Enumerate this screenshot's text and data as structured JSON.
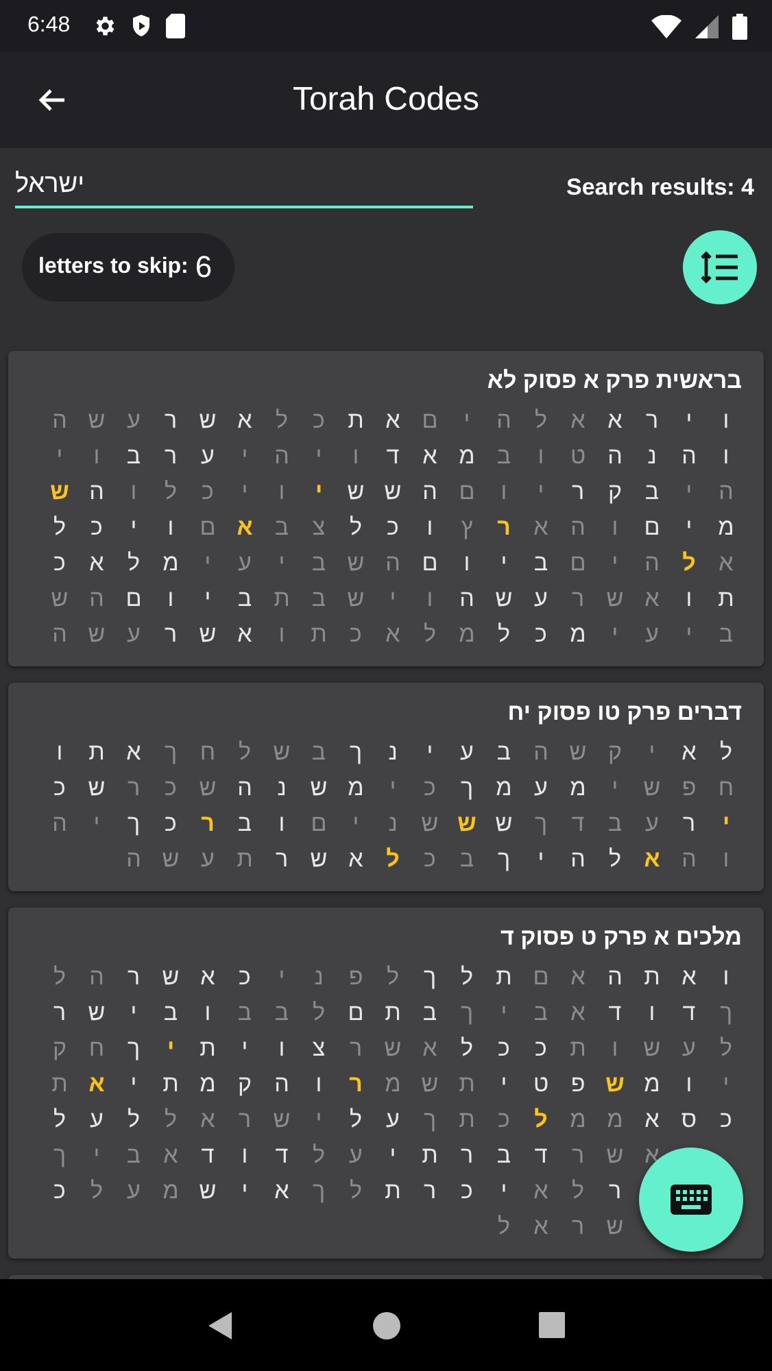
{
  "status_bar": {
    "time": "6:48"
  },
  "app_bar": {
    "title": "Torah Codes"
  },
  "search": {
    "value": "ישראל",
    "results": "Search results: 4"
  },
  "skip": {
    "label": "letters to skip:",
    "value": "6"
  },
  "results": [
    {
      "title": "בראשית פרק א פסוק לא",
      "rows": [
        [
          {
            "c": "ו",
            "kind": "plain"
          },
          {
            "c": "י",
            "kind": "plain"
          },
          {
            "c": "ר",
            "kind": "plain"
          },
          {
            "c": "א",
            "kind": "plain"
          },
          {
            "c": "א",
            "kind": "dim"
          },
          {
            "c": "ל",
            "kind": "dim"
          },
          {
            "c": "ה",
            "kind": "dim"
          },
          {
            "c": "י",
            "kind": "dim"
          },
          {
            "c": "ם",
            "kind": "dim"
          },
          {
            "c": "א",
            "kind": "plain"
          },
          {
            "c": "ת",
            "kind": "plain"
          },
          {
            "c": "כ",
            "kind": "dim"
          },
          {
            "c": "ל",
            "kind": "dim"
          },
          {
            "c": "א",
            "kind": "plain"
          },
          {
            "c": "ש",
            "kind": "plain"
          },
          {
            "c": "ר",
            "kind": "plain"
          },
          {
            "c": "ע",
            "kind": "dim"
          },
          {
            "c": "ש",
            "kind": "dim"
          },
          {
            "c": "ה",
            "kind": "dim"
          }
        ],
        [
          {
            "c": "ו",
            "kind": "plain"
          },
          {
            "c": "ה",
            "kind": "plain"
          },
          {
            "c": "נ",
            "kind": "plain"
          },
          {
            "c": "ה",
            "kind": "plain"
          },
          {
            "c": "ט",
            "kind": "dim"
          },
          {
            "c": "ו",
            "kind": "dim"
          },
          {
            "c": "ב",
            "kind": "dim"
          },
          {
            "c": "מ",
            "kind": "plain"
          },
          {
            "c": "א",
            "kind": "plain"
          },
          {
            "c": "ד",
            "kind": "plain"
          },
          {
            "c": "ו",
            "kind": "dim"
          },
          {
            "c": "י",
            "kind": "dim"
          },
          {
            "c": "ה",
            "kind": "dim"
          },
          {
            "c": "י",
            "kind": "dim"
          },
          {
            "c": "ע",
            "kind": "plain"
          },
          {
            "c": "ר",
            "kind": "plain"
          },
          {
            "c": "ב",
            "kind": "plain"
          },
          {
            "c": "ו",
            "kind": "dim"
          },
          {
            "c": "י",
            "kind": "dim"
          }
        ],
        [
          {
            "c": "ה",
            "kind": "dim"
          },
          {
            "c": "י",
            "kind": "dim"
          },
          {
            "c": "ב",
            "kind": "plain"
          },
          {
            "c": "ק",
            "kind": "plain"
          },
          {
            "c": "ר",
            "kind": "plain"
          },
          {
            "c": "י",
            "kind": "dim"
          },
          {
            "c": "ו",
            "kind": "dim"
          },
          {
            "c": "ם",
            "kind": "dim"
          },
          {
            "c": "ה",
            "kind": "plain"
          },
          {
            "c": "ש",
            "kind": "plain"
          },
          {
            "c": "ש",
            "kind": "plain"
          },
          {
            "c": "י",
            "kind": "found"
          },
          {
            "c": "ו",
            "kind": "dim"
          },
          {
            "c": "י",
            "kind": "dim"
          },
          {
            "c": "כ",
            "kind": "dim"
          },
          {
            "c": "ל",
            "kind": "dim"
          },
          {
            "c": "ו",
            "kind": "dim"
          },
          {
            "c": "ה",
            "kind": "plain"
          },
          {
            "c": "ש",
            "kind": "found"
          }
        ],
        [
          {
            "c": "מ",
            "kind": "plain"
          },
          {
            "c": "י",
            "kind": "plain"
          },
          {
            "c": "ם",
            "kind": "plain"
          },
          {
            "c": "ו",
            "kind": "dim"
          },
          {
            "c": "ה",
            "kind": "dim"
          },
          {
            "c": "א",
            "kind": "dim"
          },
          {
            "c": "ר",
            "kind": "found"
          },
          {
            "c": "ץ",
            "kind": "dim"
          },
          {
            "c": "ו",
            "kind": "plain"
          },
          {
            "c": "כ",
            "kind": "plain"
          },
          {
            "c": "ל",
            "kind": "plain"
          },
          {
            "c": "צ",
            "kind": "dim"
          },
          {
            "c": "ב",
            "kind": "dim"
          },
          {
            "c": "א",
            "kind": "found"
          },
          {
            "c": "ם",
            "kind": "dim"
          },
          {
            "c": "ו",
            "kind": "plain"
          },
          {
            "c": "י",
            "kind": "plain"
          },
          {
            "c": "כ",
            "kind": "plain"
          },
          {
            "c": "ל",
            "kind": "plain"
          }
        ],
        [
          {
            "c": "א",
            "kind": "dim"
          },
          {
            "c": "ל",
            "kind": "found"
          },
          {
            "c": "ה",
            "kind": "dim"
          },
          {
            "c": "י",
            "kind": "dim"
          },
          {
            "c": "ם",
            "kind": "dim"
          },
          {
            "c": "ב",
            "kind": "plain"
          },
          {
            "c": "י",
            "kind": "plain"
          },
          {
            "c": "ו",
            "kind": "plain"
          },
          {
            "c": "ם",
            "kind": "plain"
          },
          {
            "c": "ה",
            "kind": "dim"
          },
          {
            "c": "ש",
            "kind": "dim"
          },
          {
            "c": "ב",
            "kind": "dim"
          },
          {
            "c": "י",
            "kind": "dim"
          },
          {
            "c": "ע",
            "kind": "dim"
          },
          {
            "c": "י",
            "kind": "dim"
          },
          {
            "c": "מ",
            "kind": "plain"
          },
          {
            "c": "ל",
            "kind": "plain"
          },
          {
            "c": "א",
            "kind": "plain"
          },
          {
            "c": "כ",
            "kind": "plain"
          }
        ],
        [
          {
            "c": "ת",
            "kind": "plain"
          },
          {
            "c": "ו",
            "kind": "plain"
          },
          {
            "c": "א",
            "kind": "dim"
          },
          {
            "c": "ש",
            "kind": "dim"
          },
          {
            "c": "ר",
            "kind": "dim"
          },
          {
            "c": "ע",
            "kind": "plain"
          },
          {
            "c": "ש",
            "kind": "plain"
          },
          {
            "c": "ה",
            "kind": "plain"
          },
          {
            "c": "ו",
            "kind": "dim"
          },
          {
            "c": "י",
            "kind": "dim"
          },
          {
            "c": "ש",
            "kind": "dim"
          },
          {
            "c": "ב",
            "kind": "dim"
          },
          {
            "c": "ת",
            "kind": "dim"
          },
          {
            "c": "ב",
            "kind": "plain"
          },
          {
            "c": "י",
            "kind": "plain"
          },
          {
            "c": "ו",
            "kind": "plain"
          },
          {
            "c": "ם",
            "kind": "plain"
          },
          {
            "c": "ה",
            "kind": "dim"
          },
          {
            "c": "ש",
            "kind": "dim"
          }
        ],
        [
          {
            "c": "ב",
            "kind": "dim"
          },
          {
            "c": "י",
            "kind": "dim"
          },
          {
            "c": "ע",
            "kind": "dim"
          },
          {
            "c": "י",
            "kind": "dim"
          },
          {
            "c": "מ",
            "kind": "plain"
          },
          {
            "c": "כ",
            "kind": "plain"
          },
          {
            "c": "ל",
            "kind": "plain"
          },
          {
            "c": "מ",
            "kind": "dim"
          },
          {
            "c": "ל",
            "kind": "dim"
          },
          {
            "c": "א",
            "kind": "dim"
          },
          {
            "c": "כ",
            "kind": "dim"
          },
          {
            "c": "ת",
            "kind": "dim"
          },
          {
            "c": "ו",
            "kind": "dim"
          },
          {
            "c": "א",
            "kind": "plain"
          },
          {
            "c": "ש",
            "kind": "plain"
          },
          {
            "c": "ר",
            "kind": "plain"
          },
          {
            "c": "ע",
            "kind": "dim"
          },
          {
            "c": "ש",
            "kind": "dim"
          },
          {
            "c": "ה",
            "kind": "dim"
          }
        ]
      ]
    },
    {
      "title": "דברים פרק טו פסוק יח",
      "rows": [
        [
          {
            "c": "ל",
            "kind": "plain"
          },
          {
            "c": "א",
            "kind": "plain"
          },
          {
            "c": "י",
            "kind": "dim"
          },
          {
            "c": "ק",
            "kind": "dim"
          },
          {
            "c": "ש",
            "kind": "dim"
          },
          {
            "c": "ה",
            "kind": "dim"
          },
          {
            "c": "ב",
            "kind": "plain"
          },
          {
            "c": "ע",
            "kind": "plain"
          },
          {
            "c": "י",
            "kind": "plain"
          },
          {
            "c": "נ",
            "kind": "plain"
          },
          {
            "c": "ך",
            "kind": "plain"
          },
          {
            "c": "ב",
            "kind": "dim"
          },
          {
            "c": "ש",
            "kind": "dim"
          },
          {
            "c": "ל",
            "kind": "dim"
          },
          {
            "c": "ח",
            "kind": "dim"
          },
          {
            "c": "ך",
            "kind": "dim"
          },
          {
            "c": "א",
            "kind": "plain"
          },
          {
            "c": "ת",
            "kind": "plain"
          },
          {
            "c": "ו",
            "kind": "plain"
          }
        ],
        [
          {
            "c": "ח",
            "kind": "dim"
          },
          {
            "c": "פ",
            "kind": "dim"
          },
          {
            "c": "ש",
            "kind": "dim"
          },
          {
            "c": "י",
            "kind": "dim"
          },
          {
            "c": "מ",
            "kind": "plain"
          },
          {
            "c": "ע",
            "kind": "plain"
          },
          {
            "c": "מ",
            "kind": "plain"
          },
          {
            "c": "ך",
            "kind": "plain"
          },
          {
            "c": "כ",
            "kind": "dim"
          },
          {
            "c": "י",
            "kind": "dim"
          },
          {
            "c": "מ",
            "kind": "plain"
          },
          {
            "c": "ש",
            "kind": "plain"
          },
          {
            "c": "נ",
            "kind": "plain"
          },
          {
            "c": "ה",
            "kind": "plain"
          },
          {
            "c": "ש",
            "kind": "dim"
          },
          {
            "c": "כ",
            "kind": "dim"
          },
          {
            "c": "ר",
            "kind": "dim"
          },
          {
            "c": "ש",
            "kind": "plain"
          },
          {
            "c": "כ",
            "kind": "plain"
          }
        ],
        [
          {
            "c": "י",
            "kind": "found"
          },
          {
            "c": "ר",
            "kind": "plain"
          },
          {
            "c": "ע",
            "kind": "dim"
          },
          {
            "c": "ב",
            "kind": "dim"
          },
          {
            "c": "ד",
            "kind": "dim"
          },
          {
            "c": "ך",
            "kind": "dim"
          },
          {
            "c": "ש",
            "kind": "plain"
          },
          {
            "c": "ש",
            "kind": "found"
          },
          {
            "c": "ש",
            "kind": "dim"
          },
          {
            "c": "נ",
            "kind": "dim"
          },
          {
            "c": "י",
            "kind": "dim"
          },
          {
            "c": "ם",
            "kind": "dim"
          },
          {
            "c": "ו",
            "kind": "plain"
          },
          {
            "c": "ב",
            "kind": "plain"
          },
          {
            "c": "ר",
            "kind": "found"
          },
          {
            "c": "כ",
            "kind": "plain"
          },
          {
            "c": "ך",
            "kind": "plain"
          },
          {
            "c": "י",
            "kind": "dim"
          },
          {
            "c": "ה",
            "kind": "dim"
          }
        ],
        [
          {
            "c": "ו",
            "kind": "dim"
          },
          {
            "c": "ה",
            "kind": "dim"
          },
          {
            "c": "א",
            "kind": "found"
          },
          {
            "c": "ל",
            "kind": "plain"
          },
          {
            "c": "ה",
            "kind": "plain"
          },
          {
            "c": "י",
            "kind": "plain"
          },
          {
            "c": "ך",
            "kind": "plain"
          },
          {
            "c": "ב",
            "kind": "dim"
          },
          {
            "c": "כ",
            "kind": "dim"
          },
          {
            "c": "ל",
            "kind": "found"
          },
          {
            "c": "א",
            "kind": "plain"
          },
          {
            "c": "ש",
            "kind": "plain"
          },
          {
            "c": "ר",
            "kind": "plain"
          },
          {
            "c": "ת",
            "kind": "dim"
          },
          {
            "c": "ע",
            "kind": "dim"
          },
          {
            "c": "ש",
            "kind": "dim"
          },
          {
            "c": "ה",
            "kind": "dim"
          }
        ]
      ]
    },
    {
      "title": "מלכים א פרק ט פסוק ד",
      "rows": [
        [
          {
            "c": "ו",
            "kind": "plain"
          },
          {
            "c": "א",
            "kind": "plain"
          },
          {
            "c": "ת",
            "kind": "plain"
          },
          {
            "c": "ה",
            "kind": "plain"
          },
          {
            "c": "א",
            "kind": "dim"
          },
          {
            "c": "ם",
            "kind": "dim"
          },
          {
            "c": "ת",
            "kind": "plain"
          },
          {
            "c": "ל",
            "kind": "plain"
          },
          {
            "c": "ך",
            "kind": "plain"
          },
          {
            "c": "ל",
            "kind": "dim"
          },
          {
            "c": "פ",
            "kind": "dim"
          },
          {
            "c": "נ",
            "kind": "dim"
          },
          {
            "c": "י",
            "kind": "dim"
          },
          {
            "c": "כ",
            "kind": "plain"
          },
          {
            "c": "א",
            "kind": "plain"
          },
          {
            "c": "ש",
            "kind": "plain"
          },
          {
            "c": "ר",
            "kind": "plain"
          },
          {
            "c": "ה",
            "kind": "dim"
          },
          {
            "c": "ל",
            "kind": "dim"
          }
        ],
        [
          {
            "c": "ך",
            "kind": "dim"
          },
          {
            "c": "ד",
            "kind": "plain"
          },
          {
            "c": "ו",
            "kind": "plain"
          },
          {
            "c": "ד",
            "kind": "plain"
          },
          {
            "c": "א",
            "kind": "dim"
          },
          {
            "c": "ב",
            "kind": "dim"
          },
          {
            "c": "י",
            "kind": "dim"
          },
          {
            "c": "ך",
            "kind": "dim"
          },
          {
            "c": "ב",
            "kind": "plain"
          },
          {
            "c": "ת",
            "kind": "plain"
          },
          {
            "c": "ם",
            "kind": "plain"
          },
          {
            "c": "ל",
            "kind": "dim"
          },
          {
            "c": "ב",
            "kind": "dim"
          },
          {
            "c": "ב",
            "kind": "dim"
          },
          {
            "c": "ו",
            "kind": "plain"
          },
          {
            "c": "ב",
            "kind": "plain"
          },
          {
            "c": "י",
            "kind": "plain"
          },
          {
            "c": "ש",
            "kind": "plain"
          },
          {
            "c": "ר",
            "kind": "plain"
          }
        ],
        [
          {
            "c": "ל",
            "kind": "dim"
          },
          {
            "c": "ע",
            "kind": "dim"
          },
          {
            "c": "ש",
            "kind": "dim"
          },
          {
            "c": "ו",
            "kind": "dim"
          },
          {
            "c": "ת",
            "kind": "dim"
          },
          {
            "c": "כ",
            "kind": "plain"
          },
          {
            "c": "כ",
            "kind": "plain"
          },
          {
            "c": "ל",
            "kind": "plain"
          },
          {
            "c": "א",
            "kind": "dim"
          },
          {
            "c": "ש",
            "kind": "dim"
          },
          {
            "c": "ר",
            "kind": "dim"
          },
          {
            "c": "צ",
            "kind": "plain"
          },
          {
            "c": "ו",
            "kind": "plain"
          },
          {
            "c": "י",
            "kind": "plain"
          },
          {
            "c": "ת",
            "kind": "plain"
          },
          {
            "c": "י",
            "kind": "found"
          },
          {
            "c": "ך",
            "kind": "plain"
          },
          {
            "c": "ח",
            "kind": "dim"
          },
          {
            "c": "ק",
            "kind": "dim"
          }
        ],
        [
          {
            "c": "י",
            "kind": "dim"
          },
          {
            "c": "ו",
            "kind": "plain"
          },
          {
            "c": "מ",
            "kind": "plain"
          },
          {
            "c": "ש",
            "kind": "found"
          },
          {
            "c": "פ",
            "kind": "plain"
          },
          {
            "c": "ט",
            "kind": "plain"
          },
          {
            "c": "י",
            "kind": "plain"
          },
          {
            "c": "ת",
            "kind": "dim"
          },
          {
            "c": "ש",
            "kind": "dim"
          },
          {
            "c": "מ",
            "kind": "dim"
          },
          {
            "c": "ר",
            "kind": "found"
          },
          {
            "c": "ו",
            "kind": "plain"
          },
          {
            "c": "ה",
            "kind": "plain"
          },
          {
            "c": "ק",
            "kind": "plain"
          },
          {
            "c": "מ",
            "kind": "plain"
          },
          {
            "c": "ת",
            "kind": "plain"
          },
          {
            "c": "י",
            "kind": "plain"
          },
          {
            "c": "א",
            "kind": "found"
          },
          {
            "c": "ת",
            "kind": "dim"
          }
        ],
        [
          {
            "c": "כ",
            "kind": "plain"
          },
          {
            "c": "ס",
            "kind": "plain"
          },
          {
            "c": "א",
            "kind": "plain"
          },
          {
            "c": "מ",
            "kind": "dim"
          },
          {
            "c": "מ",
            "kind": "dim"
          },
          {
            "c": "ל",
            "kind": "found"
          },
          {
            "c": "כ",
            "kind": "dim"
          },
          {
            "c": "ת",
            "kind": "dim"
          },
          {
            "c": "ך",
            "kind": "dim"
          },
          {
            "c": "ע",
            "kind": "plain"
          },
          {
            "c": "ל",
            "kind": "plain"
          },
          {
            "c": "י",
            "kind": "dim"
          },
          {
            "c": "ש",
            "kind": "dim"
          },
          {
            "c": "ר",
            "kind": "dim"
          },
          {
            "c": "א",
            "kind": "dim"
          },
          {
            "c": "ל",
            "kind": "dim"
          },
          {
            "c": "ל",
            "kind": "plain"
          },
          {
            "c": "ע",
            "kind": "plain"
          },
          {
            "c": "ל",
            "kind": "plain"
          }
        ],
        [
          null,
          null,
          {
            "c": "א",
            "kind": "dim"
          },
          {
            "c": "ש",
            "kind": "dim"
          },
          {
            "c": "ר",
            "kind": "dim"
          },
          {
            "c": "ד",
            "kind": "plain"
          },
          {
            "c": "ב",
            "kind": "plain"
          },
          {
            "c": "ר",
            "kind": "plain"
          },
          {
            "c": "ת",
            "kind": "plain"
          },
          {
            "c": "י",
            "kind": "plain"
          },
          {
            "c": "ע",
            "kind": "dim"
          },
          {
            "c": "ל",
            "kind": "dim"
          },
          {
            "c": "ד",
            "kind": "plain"
          },
          {
            "c": "ו",
            "kind": "plain"
          },
          {
            "c": "ד",
            "kind": "plain"
          },
          {
            "c": "א",
            "kind": "dim"
          },
          {
            "c": "ב",
            "kind": "dim"
          },
          {
            "c": "י",
            "kind": "dim"
          },
          {
            "c": "ך",
            "kind": "dim"
          }
        ],
        [
          null,
          null,
          null,
          {
            "c": "ר",
            "kind": "plain"
          },
          {
            "c": "ל",
            "kind": "dim"
          },
          {
            "c": "א",
            "kind": "dim"
          },
          {
            "c": "י",
            "kind": "plain"
          },
          {
            "c": "כ",
            "kind": "plain"
          },
          {
            "c": "ר",
            "kind": "plain"
          },
          {
            "c": "ת",
            "kind": "plain"
          },
          {
            "c": "ל",
            "kind": "dim"
          },
          {
            "c": "ך",
            "kind": "dim"
          },
          {
            "c": "א",
            "kind": "plain"
          },
          {
            "c": "י",
            "kind": "plain"
          },
          {
            "c": "ש",
            "kind": "plain"
          },
          {
            "c": "מ",
            "kind": "dim"
          },
          {
            "c": "ע",
            "kind": "dim"
          },
          {
            "c": "ל",
            "kind": "dim"
          },
          {
            "c": "כ",
            "kind": "plain"
          }
        ],
        [
          null,
          null,
          null,
          {
            "c": "ש",
            "kind": "dim"
          },
          {
            "c": "ר",
            "kind": "dim"
          },
          {
            "c": "א",
            "kind": "dim"
          },
          {
            "c": "ל",
            "kind": "dim"
          }
        ]
      ]
    }
  ]
}
